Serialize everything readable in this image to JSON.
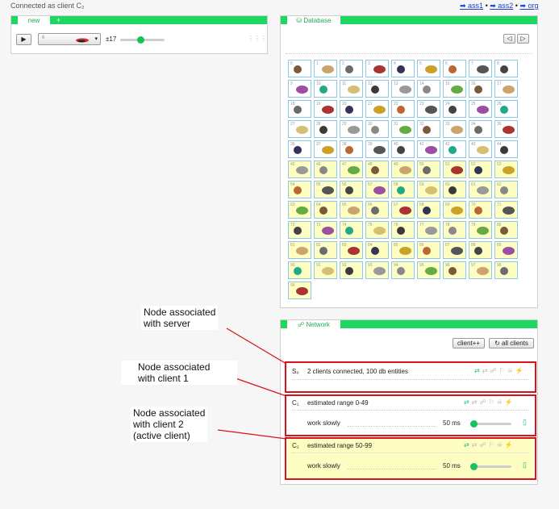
{
  "status": {
    "connected_as": "Connected as client C₂"
  },
  "links": [
    {
      "label": "➡ ass1"
    },
    {
      "label": "➡ ass2"
    },
    {
      "label": "➡ org"
    }
  ],
  "top_panel": {
    "tab_label": "new",
    "tab_add": "+",
    "play_icon": "play-icon",
    "select_value": "6",
    "range_label": "±17",
    "slider_fraction": 0.46,
    "dots": "⋮⋮⋮"
  },
  "database": {
    "tab_label": "⛁ Database",
    "prev": "◁",
    "next": "▷",
    "total_items": 100,
    "cells": [
      "0",
      "1",
      "2",
      "3",
      "4",
      "5",
      "6",
      "7",
      "8",
      "9",
      "10",
      "11",
      "12",
      "13",
      "14",
      "15",
      "16",
      "17",
      "18",
      "19",
      "20",
      "21",
      "22",
      "23",
      "24",
      "25",
      "26",
      "27",
      "28",
      "29",
      "30",
      "31",
      "32",
      "33",
      "34",
      "35",
      "36",
      "37",
      "38",
      "39",
      "40",
      "41",
      "42",
      "43",
      "44",
      "45",
      "46",
      "47",
      "48",
      "49",
      "50",
      "51",
      "52",
      "53",
      "54",
      "55",
      "56",
      "57",
      "58",
      "59",
      "60",
      "61",
      "62",
      "63",
      "64",
      "65",
      "66",
      "67",
      "68",
      "69",
      "70",
      "71",
      "72",
      "73",
      "74",
      "75",
      "76",
      "77",
      "78",
      "79",
      "80",
      "81",
      "82",
      "83",
      "84",
      "85",
      "86",
      "87",
      "88",
      "89",
      "90",
      "91",
      "92",
      "93",
      "94",
      "95",
      "96",
      "97",
      "98",
      "99"
    ]
  },
  "network": {
    "tab_label": "☍ Network",
    "add_client": "client++",
    "refresh_all": "↻ all clients",
    "nodes": [
      {
        "id": "S₀",
        "text": "2 clients connected, 100 db entities"
      },
      {
        "id": "C₁",
        "text": "estimated range 0-49",
        "work_label": "work slowly",
        "ms": "50 ms",
        "slider_fraction": 0.05
      },
      {
        "id": "C₂",
        "text": "estimated range 50-99",
        "work_label": "work slowly",
        "ms": "50 ms",
        "slider_fraction": 0.05
      }
    ],
    "icons": [
      "⇄",
      "⇄",
      "☍",
      "⚐",
      "☠",
      "⚡"
    ]
  },
  "annotations": [
    {
      "text": "Node associated\nwith server"
    },
    {
      "text": "Node associated\nwith client 1"
    },
    {
      "text": "Node associated\nwith client 2\n(active client)"
    }
  ],
  "colors": {
    "accent": "#1ed760",
    "highlight": "#fefec3",
    "annotation": "#d9121b"
  }
}
